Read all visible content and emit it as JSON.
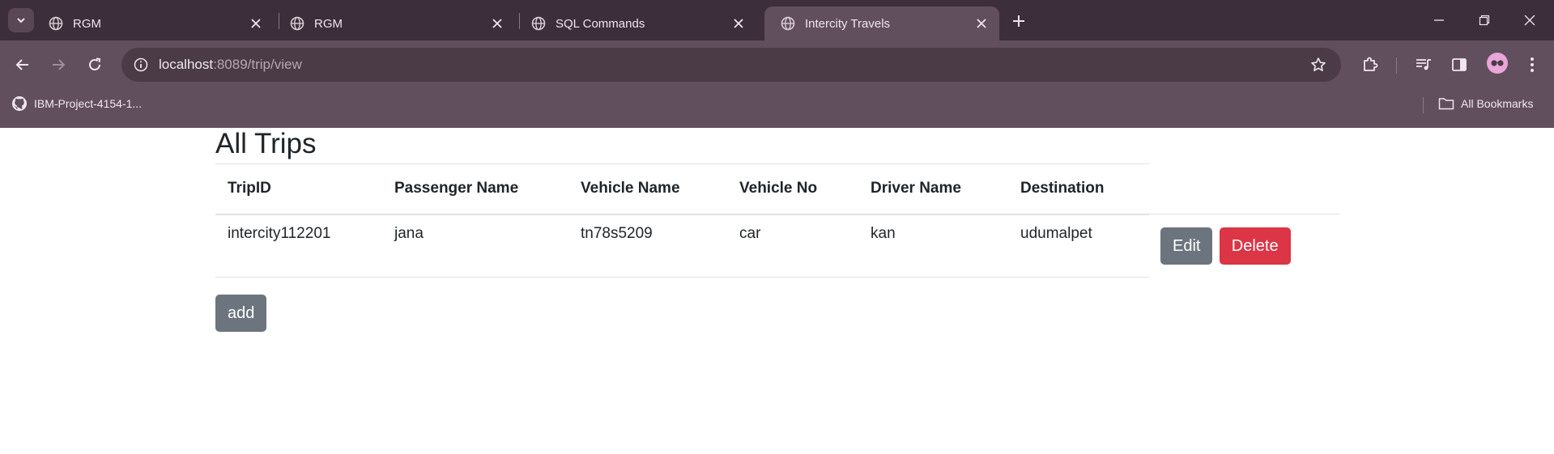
{
  "browser": {
    "tabs": [
      {
        "title": "RGM",
        "active": false
      },
      {
        "title": "RGM",
        "active": false
      },
      {
        "title": "SQL Commands",
        "active": false
      },
      {
        "title": "Intercity Travels",
        "active": true
      }
    ],
    "url_host": "localhost",
    "url_path": ":8089/trip/view",
    "bookmarks": [
      {
        "label": "IBM-Project-4154-1...",
        "icon": "github-icon"
      }
    ],
    "all_bookmarks_label": "All Bookmarks"
  },
  "page": {
    "title": "All Trips",
    "table": {
      "headers": [
        "TripID",
        "Passenger Name",
        "Vehicle Name",
        "Vehicle No",
        "Driver Name",
        "Destination"
      ],
      "rows": [
        {
          "cells": [
            "intercity112201",
            "jana",
            "tn78s5209",
            "car",
            "kan",
            "udumalpet"
          ],
          "edit_label": "Edit",
          "delete_label": "Delete"
        }
      ]
    },
    "add_label": "add"
  },
  "colors": {
    "tabstrip": "#3c2e3a",
    "toolbar": "#614f5e",
    "secondary": "#6c757d",
    "danger": "#dc3545"
  }
}
